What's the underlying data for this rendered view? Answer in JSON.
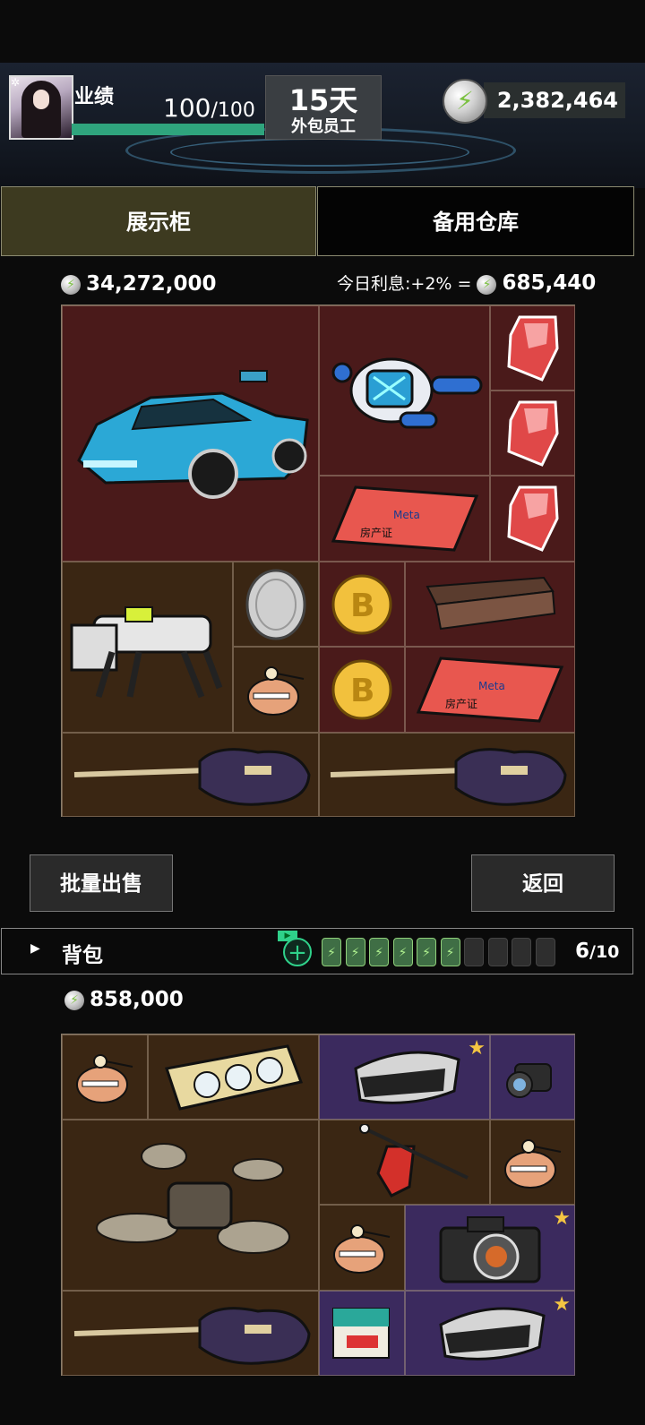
{
  "header": {
    "performance_label": "业绩",
    "performance_current": "100",
    "performance_max": "/100",
    "performance_fraction": 1.0,
    "day_count": "15天",
    "role": "外包员工",
    "currency": "2,382,464"
  },
  "tabs": {
    "showcase": "展示柜",
    "storage": "备用仓库",
    "active": "showcase"
  },
  "showcase": {
    "total_value": "34,272,000",
    "interest_label": "今日利息:+2% =",
    "interest_value": "685,440",
    "items": [
      {
        "name": "sports-car",
        "icon": "car-icon"
      },
      {
        "name": "robot-drone",
        "icon": "robot-icon"
      },
      {
        "name": "red-crystal",
        "icon": "crystal-icon"
      },
      {
        "name": "red-crystal",
        "icon": "crystal-icon"
      },
      {
        "name": "red-crystal",
        "icon": "crystal-icon"
      },
      {
        "name": "meta-deed",
        "icon": "deed-icon",
        "label": "房产证",
        "brand": "Meta"
      },
      {
        "name": "robot-dog",
        "icon": "robot-dog-icon"
      },
      {
        "name": "silver-coin",
        "icon": "coin-icon"
      },
      {
        "name": "bitcoin",
        "icon": "bitcoin-icon"
      },
      {
        "name": "gold-bar",
        "icon": "bar-icon"
      },
      {
        "name": "mascot",
        "icon": "mascot-icon"
      },
      {
        "name": "bitcoin",
        "icon": "bitcoin-icon"
      },
      {
        "name": "meta-deed",
        "icon": "deed-icon",
        "label": "房产证",
        "brand": "Meta"
      },
      {
        "name": "guitar",
        "icon": "guitar-icon"
      },
      {
        "name": "guitar",
        "icon": "guitar-icon"
      }
    ]
  },
  "actions": {
    "bulk_sell": "批量出售",
    "back": "返回"
  },
  "backpack": {
    "title": "背包",
    "capacity_used": "6",
    "capacity_max": "/10",
    "batteries_filled": 6,
    "batteries_total": 10,
    "total_value": "858,000",
    "items": [
      {
        "name": "mascot",
        "icon": "mascot-icon"
      },
      {
        "name": "graphics-card",
        "icon": "gpu-icon"
      },
      {
        "name": "vr-headset",
        "icon": "vr-icon",
        "starred": true
      },
      {
        "name": "scope",
        "icon": "scope-icon"
      },
      {
        "name": "drone",
        "icon": "drone-icon"
      },
      {
        "name": "red-tool",
        "icon": "tool-icon"
      },
      {
        "name": "mascot",
        "icon": "mascot-icon"
      },
      {
        "name": "mascot",
        "icon": "mascot-icon"
      },
      {
        "name": "camera",
        "icon": "camera-icon",
        "starred": true
      },
      {
        "name": "guitar",
        "icon": "guitar-icon"
      },
      {
        "name": "postcard",
        "icon": "postcard-icon"
      },
      {
        "name": "vr-headset",
        "icon": "vr-icon",
        "starred": true
      }
    ]
  },
  "colors": {
    "accent_green": "#2fa47d",
    "star": "#f4c542",
    "cell_red": "#4a1a1a",
    "cell_brown": "#3a2613",
    "cell_purple": "#3b2a5e"
  }
}
